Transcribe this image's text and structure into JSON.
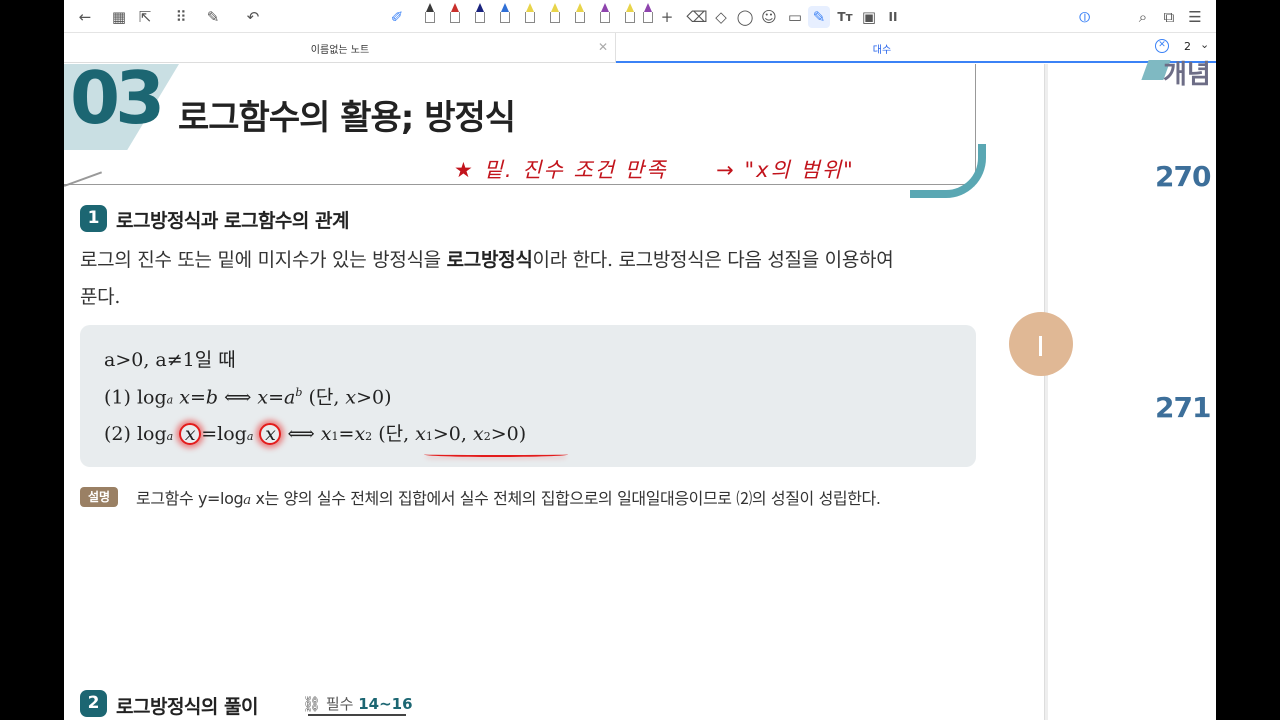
{
  "toolbar": {
    "icons": [
      "back-arrow-icon",
      "grid-icon",
      "export-icon",
      "apps-icon",
      "edit-icon",
      "undo-icon",
      "pen-icon",
      "eraser-icon",
      "shapes-icon",
      "lasso-icon",
      "sticker-icon",
      "comment-icon",
      "highlighter-icon",
      "text-icon",
      "image-icon",
      "pause-icon",
      "mic-icon",
      "search-icon",
      "reader-icon",
      "menu-icon"
    ],
    "pen_colors": [
      "#3a3a3a",
      "#c9302c",
      "#1a237e",
      "#2f6fd6",
      "#e8d44a",
      "#e8d44a",
      "#e8d44a",
      "#8e44ad",
      "#e8d44a",
      "#8e44ad"
    ],
    "add_label": "+",
    "pause_label": "II",
    "text_label": "Tт"
  },
  "tabs": {
    "tab1_label": "이름없는 노트",
    "tab2_label": "대수",
    "page_number": "2"
  },
  "page": {
    "chapter_num": "03",
    "chapter_title": "로그함수의 활용; 방정식",
    "annotation": "★ 밑. 진수 조건 만족",
    "annotation_arrow": "→",
    "annotation_tail": "\"x의 범위\"",
    "section1_num": "1",
    "section1_title": "로그방정식과 로그함수의 관계",
    "intro_line1": "로그의 진수 또는 밑에 미지수가 있는 방정식을 ",
    "intro_bold": "로그방정식",
    "intro_line1b": "이라 한다. 로그방정식은 다음 성질을 이용하여",
    "intro_line2": "푼다.",
    "formula_line1": "a>0, a≠1일 때",
    "formula_line2": "(1) log",
    "formula_line3": "(2) log",
    "desc_badge": "설명",
    "desc_text": "로그함수 y=log",
    "desc_text2": "x는 양의 실수 전체의 집합에서 실수 전체의 집합으로의 일대일대응이므로 ⑵의 성질이 성립한다.",
    "section2_num": "2",
    "section2_title": "로그방정식의 풀이",
    "req_label": "필수",
    "req_range": "14~16"
  },
  "right": {
    "head_text": "개념",
    "problems": [
      "270",
      "271"
    ]
  }
}
